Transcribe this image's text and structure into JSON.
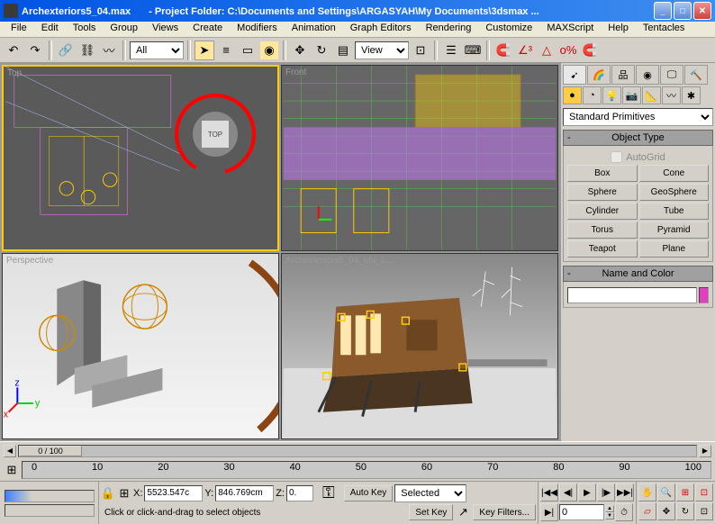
{
  "titlebar": {
    "filename": "Archexteriors5_04.max",
    "project": "- Project Folder: C:\\Documents and Settings\\ARGASYAH\\My Documents\\3dsmax  ..."
  },
  "menu": {
    "items": [
      "File",
      "Edit",
      "Tools",
      "Group",
      "Views",
      "Create",
      "Modifiers",
      "Animation",
      "Graph Editors",
      "Rendering",
      "Customize",
      "MAXScript",
      "Help",
      "Tentacles"
    ]
  },
  "toolbar": {
    "selection_filter": "All",
    "ref_coord": "View"
  },
  "viewports": {
    "top_left": "Top",
    "top_right": "Front",
    "bottom_left": "Perspective",
    "bottom_right": "Archexteriors5_04_obi_1...",
    "viewcube_label": "TOP"
  },
  "command_panel": {
    "dropdown": "Standard Primitives",
    "object_type_header": "Object Type",
    "autogrid_label": "AutoGrid",
    "buttons": [
      "Box",
      "Cone",
      "Sphere",
      "GeoSphere",
      "Cylinder",
      "Tube",
      "Torus",
      "Pyramid",
      "Teapot",
      "Plane"
    ],
    "name_color_header": "Name and Color"
  },
  "timeline": {
    "frame_display": "0 / 100",
    "ticks": [
      "0",
      "10",
      "20",
      "30",
      "40",
      "50",
      "60",
      "70",
      "80",
      "90",
      "100"
    ]
  },
  "status": {
    "x_label": "X:",
    "x_value": "5523.547c",
    "y_label": "Y:",
    "y_value": "846.769cm",
    "z_label": "Z:",
    "z_value": "0.",
    "autokey": "Auto Key",
    "setkey": "Set Key",
    "key_filters": "Key Filters...",
    "key_mode": "Selected",
    "frame_current": "0",
    "prompt": "Click or click-and-drag to select objects"
  },
  "colors": {
    "accent": "#ffcc00",
    "swatch": "#e040c0"
  }
}
